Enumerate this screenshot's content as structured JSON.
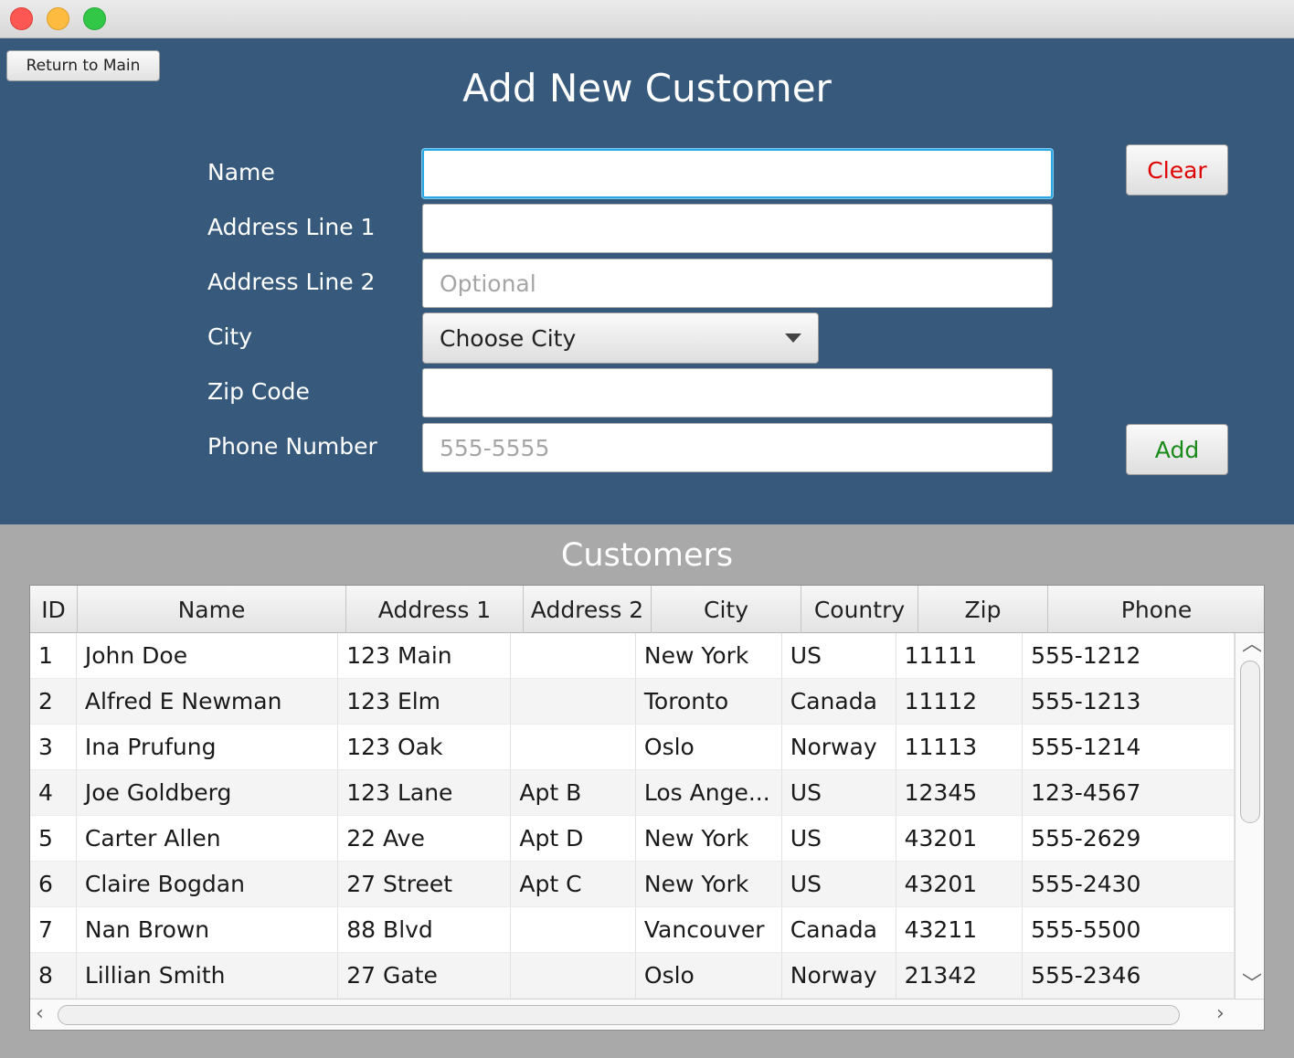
{
  "form": {
    "return_label": "Return to Main",
    "title": "Add New Customer",
    "fields": {
      "name": {
        "label": "Name",
        "value": "",
        "placeholder": ""
      },
      "address1": {
        "label": "Address Line 1",
        "value": "",
        "placeholder": ""
      },
      "address2": {
        "label": "Address Line 2",
        "value": "",
        "placeholder": "Optional"
      },
      "city": {
        "label": "City",
        "selected": "Choose City"
      },
      "zip": {
        "label": "Zip Code",
        "value": "",
        "placeholder": ""
      },
      "phone": {
        "label": "Phone Number",
        "value": "",
        "placeholder": "555-5555"
      }
    },
    "clear_label": "Clear",
    "add_label": "Add"
  },
  "table": {
    "title": "Customers",
    "columns": [
      "ID",
      "Name",
      "Address 1",
      "Address 2",
      "City",
      "Country",
      "Zip",
      "Phone"
    ],
    "rows": [
      [
        "1",
        "John Doe",
        "123 Main",
        "",
        "New York",
        "US",
        "11111",
        "555-1212"
      ],
      [
        "2",
        "Alfred E Newman",
        "123 Elm",
        "",
        "Toronto",
        "Canada",
        "11112",
        "555-1213"
      ],
      [
        "3",
        "Ina Prufung",
        "123 Oak",
        "",
        "Oslo",
        "Norway",
        "11113",
        "555-1214"
      ],
      [
        "4",
        "Joe Goldberg",
        "123 Lane",
        "Apt B",
        "Los Ange...",
        "US",
        "12345",
        "123-4567"
      ],
      [
        "5",
        "Carter Allen",
        "22 Ave",
        "Apt D",
        "New York",
        "US",
        "43201",
        "555-2629"
      ],
      [
        "6",
        "Claire Bogdan",
        "27 Street",
        "Apt C",
        "New York",
        "US",
        "43201",
        "555-2430"
      ],
      [
        "7",
        "Nan Brown",
        "88 Blvd",
        "",
        "Vancouver",
        "Canada",
        "43211",
        "555-5500"
      ],
      [
        "8",
        "Lillian Smith",
        "27 Gate",
        "",
        "Oslo",
        "Norway",
        "21342",
        "555-2346"
      ]
    ]
  },
  "colors": {
    "form_background": "#375a7c",
    "lower_background": "#a9a9a9",
    "clear_text": "#e00000",
    "add_text": "#1a8a1a",
    "focus_ring": "#2aa6e2"
  },
  "icons": {
    "combo": "chevron-down-icon",
    "scroll_up": "chevron-up-icon",
    "scroll_down": "chevron-down-icon",
    "scroll_left": "chevron-left-icon",
    "scroll_right": "chevron-right-icon"
  }
}
